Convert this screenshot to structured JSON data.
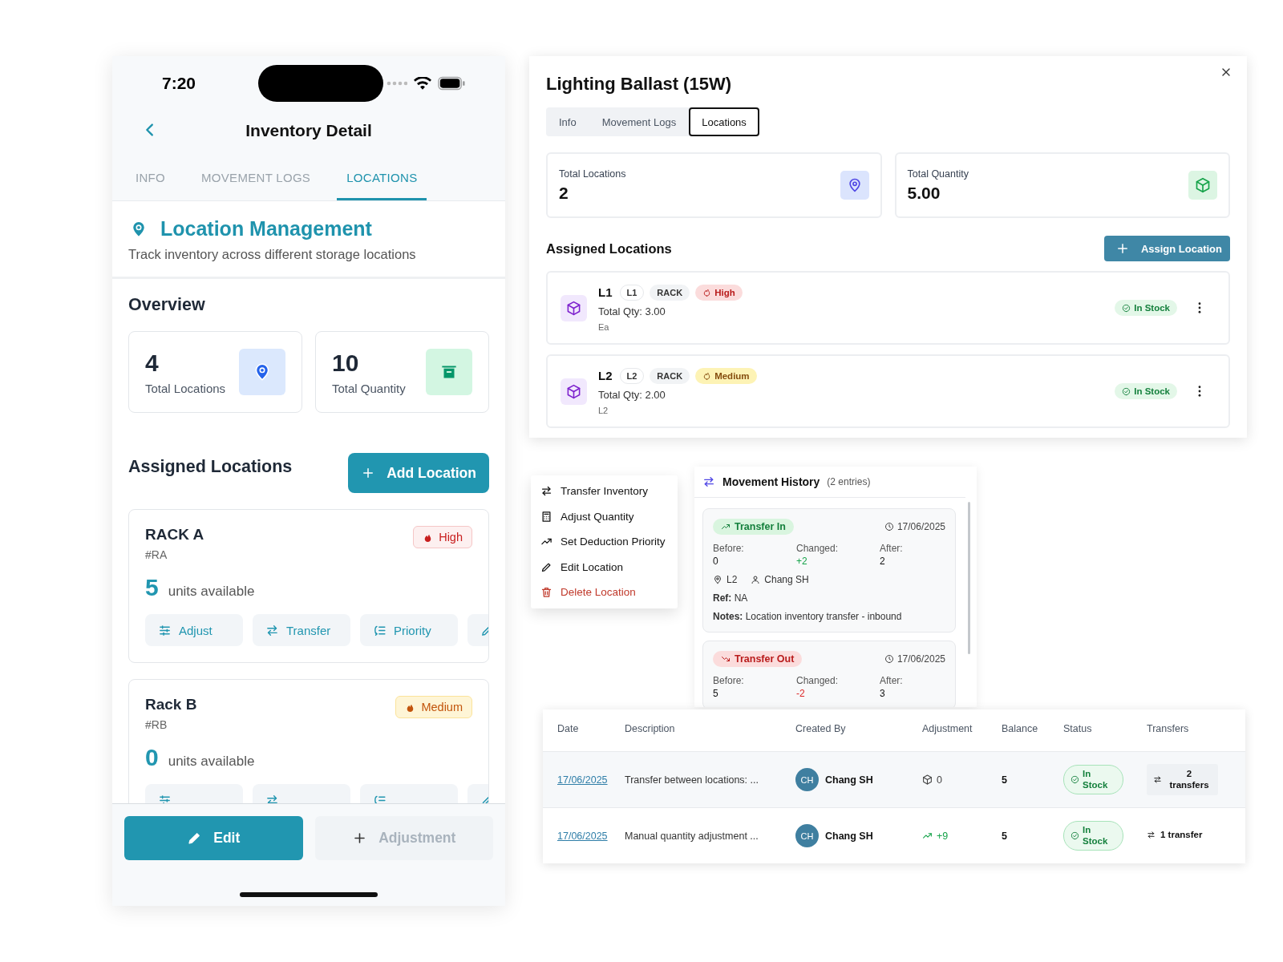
{
  "phone": {
    "status_time": "7:20",
    "title": "Inventory Detail",
    "tabs": [
      {
        "label": "INFO",
        "selected": false
      },
      {
        "label": "MOVEMENT LOGS",
        "selected": false
      },
      {
        "label": "LOCATIONS",
        "selected": true
      }
    ],
    "section": {
      "title": "Location Management",
      "subtitle": "Track inventory across different storage locations"
    },
    "overview_title": "Overview",
    "stats": [
      {
        "value": "4",
        "label": "Total Locations",
        "kind": "location"
      },
      {
        "value": "10",
        "label": "Total Quantity",
        "kind": "quantity"
      }
    ],
    "assigned_title": "Assigned Locations",
    "add_button": "Add Location",
    "locations": [
      {
        "name": "RACK A",
        "code": "#RA",
        "priority": {
          "label": "High",
          "kind": "high"
        },
        "units": "5",
        "units_label": "units available",
        "actions": [
          {
            "label": "Adjust",
            "kind": "adjust"
          },
          {
            "label": "Transfer",
            "kind": "transfer"
          },
          {
            "label": "Priority",
            "kind": "priority"
          },
          {
            "kind": "edit"
          }
        ]
      },
      {
        "name": "Rack B",
        "code": "#RB",
        "priority": {
          "label": "Medium",
          "kind": "medium"
        },
        "units": "0",
        "units_label": "units available",
        "actions": [
          {
            "kind": "adjust"
          },
          {
            "kind": "transfer"
          },
          {
            "kind": "priority"
          },
          {
            "kind": "edit"
          }
        ]
      }
    ],
    "footer": {
      "edit": "Edit",
      "adjustment": {
        "label": "Adjustment",
        "disabled": true
      }
    }
  },
  "modal": {
    "title": "Lighting Ballast (15W)",
    "tabs": [
      {
        "label": "Info",
        "selected": false
      },
      {
        "label": "Movement Logs",
        "selected": false
      },
      {
        "label": "Locations",
        "selected": true
      }
    ],
    "stats": [
      {
        "label": "Total Locations",
        "value": "2",
        "kind": "location"
      },
      {
        "label": "Total Quantity",
        "value": "5.00",
        "kind": "quantity"
      }
    ],
    "assigned_title": "Assigned Locations",
    "assign_button": "Assign Location",
    "locations": [
      {
        "name": "L1",
        "tags": [
          "L1",
          "RACK"
        ],
        "priority": {
          "label": "High",
          "kind": "high"
        },
        "qty": "Total Qty: 3.00",
        "unit": "Ea",
        "status": "In Stock"
      },
      {
        "name": "L2",
        "tags": [
          "L2",
          "RACK"
        ],
        "priority": {
          "label": "Medium",
          "kind": "medium"
        },
        "qty": "Total Qty: 2.00",
        "unit": "L2",
        "status": "In Stock"
      }
    ]
  },
  "action_menu": {
    "items": [
      {
        "label": "Transfer Inventory",
        "kind": "transfer",
        "danger": false
      },
      {
        "label": "Adjust Quantity",
        "kind": "calculator",
        "danger": false
      },
      {
        "label": "Set Deduction Priority",
        "kind": "trend",
        "danger": false
      },
      {
        "label": "Edit Location",
        "kind": "edit",
        "danger": false
      },
      {
        "label": "Delete Location",
        "kind": "delete",
        "danger": true
      }
    ]
  },
  "movement_history": {
    "title": "Movement History",
    "count": "(2 entries)",
    "entries": [
      {
        "type": "Transfer In",
        "kind": "in",
        "date": "17/06/2025",
        "fields": [
          {
            "label": "Before:",
            "value": "0"
          },
          {
            "label": "Changed:",
            "value": "+2"
          },
          {
            "label": "After:",
            "value": "2"
          }
        ],
        "location": "L2",
        "user": "Chang SH",
        "ref": "**Ref:** NA",
        "notes": "**Notes:** Location inventory transfer - inbound"
      },
      {
        "type": "Transfer Out",
        "kind": "out",
        "date": "17/06/2025",
        "fields": [
          {
            "label": "Before:",
            "value": "5"
          },
          {
            "label": "Changed:",
            "value": "-2"
          },
          {
            "label": "After:",
            "value": "3"
          }
        ]
      }
    ]
  },
  "table": {
    "columns": [
      "Date",
      "Description",
      "Created By",
      "Adjustment",
      "Balance",
      "Status",
      "Transfers"
    ],
    "rows": [
      {
        "date": "17/06/2025",
        "description": "Transfer between locations: ...",
        "initials": "CH",
        "created_by": "Chang SH",
        "adjustment": {
          "value": "0",
          "kind": "neutral"
        },
        "balance": "5",
        "status": "In Stock",
        "transfers": "2 transfers",
        "highlighted": true
      },
      {
        "date": "17/06/2025",
        "description": "Manual quantity adjustment ...",
        "initials": "CH",
        "created_by": "Chang SH",
        "adjustment": {
          "value": "+9",
          "kind": "up"
        },
        "balance": "5",
        "status": "In Stock",
        "transfers": "1 transfer",
        "highlighted": false
      }
    ]
  }
}
